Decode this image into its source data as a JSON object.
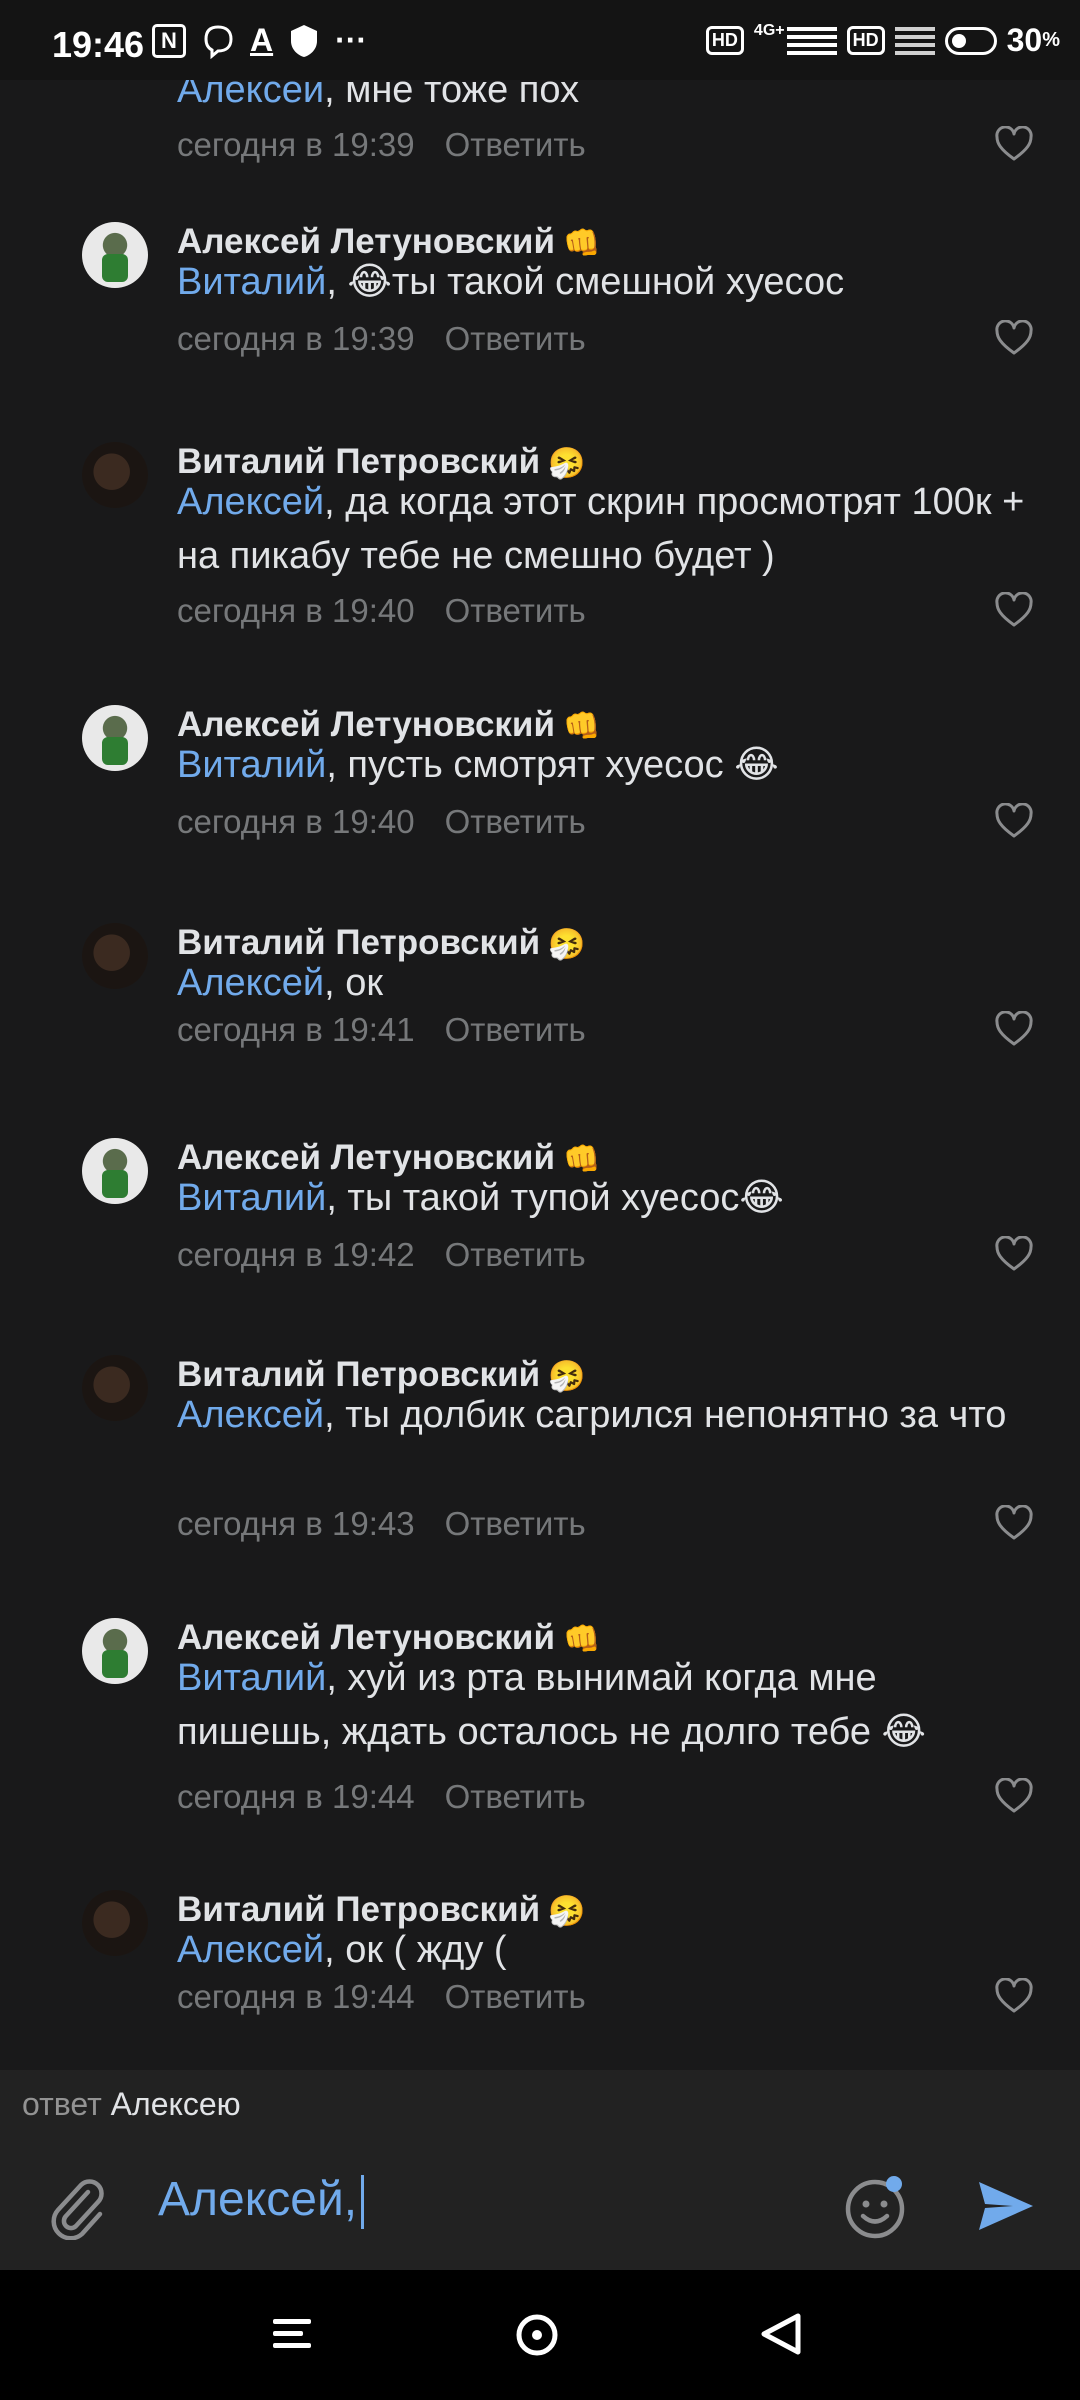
{
  "status_bar": {
    "time": "19:46",
    "left_icons": [
      "nfc-icon",
      "viber-icon",
      "text-a-icon",
      "vpn-shield-icon",
      "more-dots-icon"
    ],
    "hd1": "HD",
    "network": "4G+",
    "hd2": "HD",
    "battery": "30",
    "battery_unit": "%"
  },
  "comments": [
    {
      "author": "",
      "author_emoji": "",
      "mention": "Алексей",
      "text": ", мне тоже пох",
      "time": "сегодня в 19:39",
      "reply": "Ответить",
      "avatar": "none"
    },
    {
      "author": "Алексей Летуновский",
      "author_emoji": "👊",
      "mention": "Виталий",
      "text": ", 😂ты такой смешной хуесос",
      "time": "сегодня в 19:39",
      "reply": "Ответить",
      "avatar": "alexey"
    },
    {
      "author": "Виталий Петровский",
      "author_emoji": "🤧",
      "mention": "Алексей",
      "text": ", да когда этот скрин просмотрят 100к + на пикабу тебе не смешно будет )",
      "time": "сегодня в 19:40",
      "reply": "Ответить",
      "avatar": "vitaly"
    },
    {
      "author": "Алексей Летуновский",
      "author_emoji": "👊",
      "mention": "Виталий",
      "text": ", пусть смотрят хуесос 😂",
      "time": "сегодня в 19:40",
      "reply": "Ответить",
      "avatar": "alexey"
    },
    {
      "author": "Виталий Петровский",
      "author_emoji": "🤧",
      "mention": "Алексей",
      "text": ", ок",
      "time": "сегодня в 19:41",
      "reply": "Ответить",
      "avatar": "vitaly"
    },
    {
      "author": "Алексей Летуновский",
      "author_emoji": "👊",
      "mention": "Виталий",
      "text": ", ты такой тупой хуесос😂",
      "time": "сегодня в 19:42",
      "reply": "Ответить",
      "avatar": "alexey"
    },
    {
      "author": "Виталий Петровский",
      "author_emoji": "🤧",
      "mention": "Алексей",
      "text": ", ты долбик сагрился непонятно за что",
      "time": "сегодня в 19:43",
      "reply": "Ответить",
      "avatar": "vitaly"
    },
    {
      "author": "Алексей Летуновский",
      "author_emoji": "👊",
      "mention": "Виталий",
      "text": ", хуй из рта вынимай когда мне пишешь, ждать осталось не долго тебе 😂",
      "time": "сегодня в 19:44",
      "reply": "Ответить",
      "avatar": "alexey"
    },
    {
      "author": "Виталий Петровский",
      "author_emoji": "🤧",
      "mention": "Алексей",
      "text": ", ок ( жду (",
      "time": "сегодня в 19:44",
      "reply": "Ответить",
      "avatar": "vitaly"
    }
  ],
  "reply_bar": {
    "prefix": "ответ",
    "name": "Алексею"
  },
  "composer": {
    "input_value": "Алексей,"
  },
  "colors": {
    "background": "#19191a",
    "mention": "#71aaeb",
    "meta": "#76787a",
    "send": "#71aaeb"
  }
}
